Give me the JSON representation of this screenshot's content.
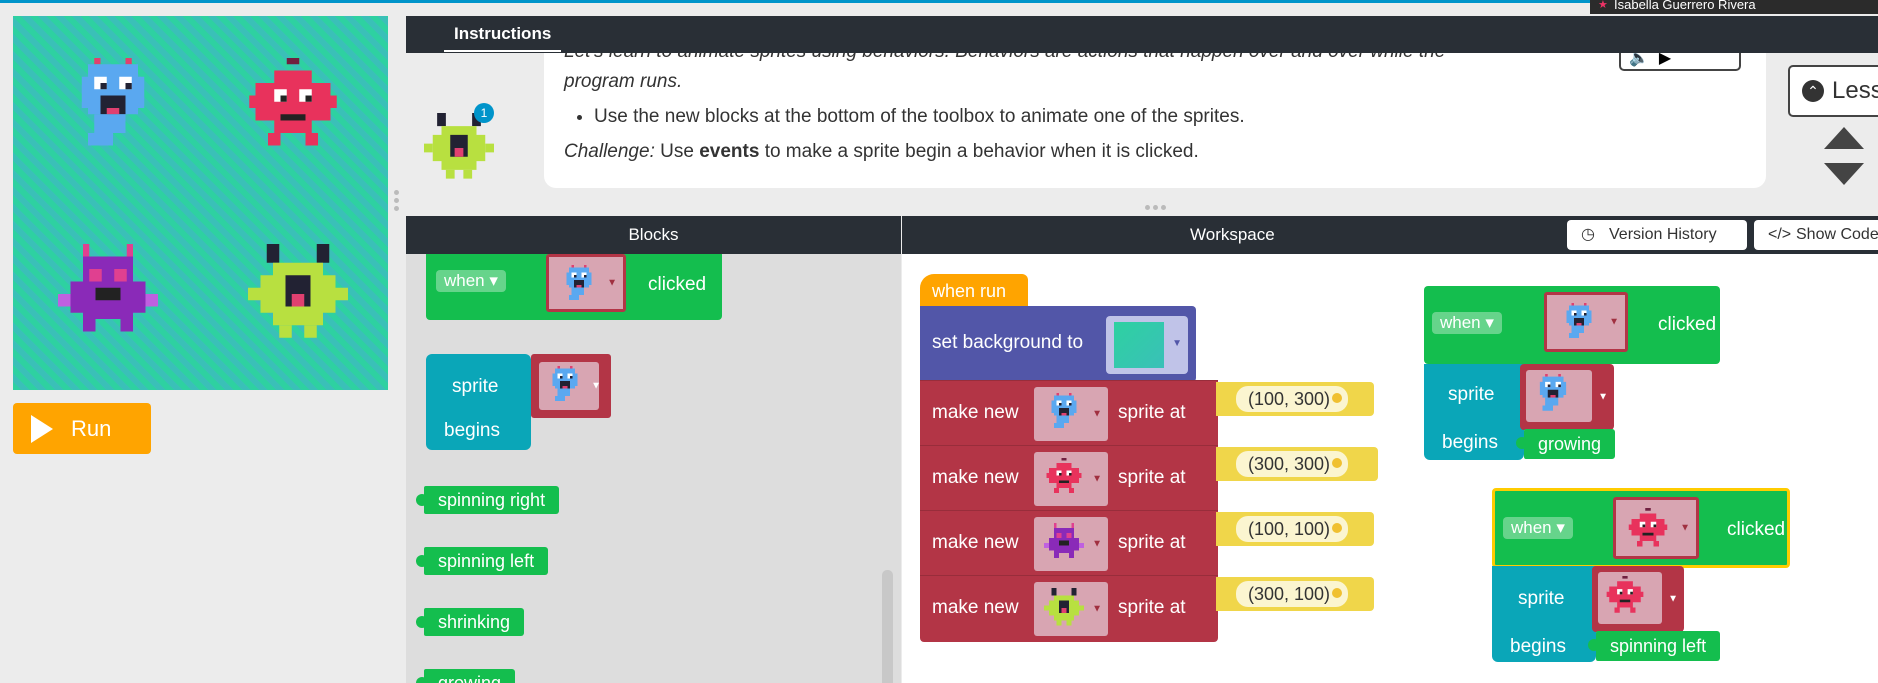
{
  "user": {
    "name": "Isabella Guerrero Rivera"
  },
  "run": {
    "label": "Run"
  },
  "instructions": {
    "tab_label": "Instructions",
    "line1": "Let's learn to animate sprites using behaviors. Behaviors are actions that happen over and over while the",
    "line2": "program runs.",
    "bullet": "Use the new blocks at the bottom of the toolbox to animate one of the sprites.",
    "challenge_prefix": "Challenge:",
    "challenge_pre": "Use",
    "challenge_bold": "events",
    "challenge_post": "to make a sprite begin a behavior when it is clicked.",
    "hint_count": "1",
    "less_label": "Less"
  },
  "blocks_panel": {
    "title": "Blocks",
    "when_label": "when",
    "clicked_label": "clicked",
    "sprite_label": "sprite",
    "begins_label": "begins",
    "behaviors": [
      "spinning right",
      "spinning left",
      "shrinking",
      "growing"
    ]
  },
  "workspace": {
    "title": "Workspace",
    "version_history": "Version History",
    "show_code": "Show Code",
    "when_run": "when run",
    "set_background": "set background to",
    "make_new": "make new",
    "sprite_at": "sprite at",
    "rows": [
      {
        "coord": "(100, 300)",
        "sprite": "blue-monster"
      },
      {
        "coord": "(300, 300)",
        "sprite": "pink-monster"
      },
      {
        "coord": "(100, 100)",
        "sprite": "purple-monster"
      },
      {
        "coord": "(300, 100)",
        "sprite": "green-monster"
      }
    ],
    "event1": {
      "when": "when",
      "clicked": "clicked",
      "sprite": "sprite",
      "begins": "begins",
      "behavior": "growing"
    },
    "event2": {
      "when": "when",
      "clicked": "clicked",
      "sprite": "sprite",
      "begins": "begins",
      "behavior": "spinning left"
    }
  },
  "colors": {
    "event_green": "#14be4e",
    "sprite_teal": "#0aa6b8",
    "make_red": "#b33546",
    "bg_purple": "#5256a8",
    "run_orange": "#ffa400"
  }
}
